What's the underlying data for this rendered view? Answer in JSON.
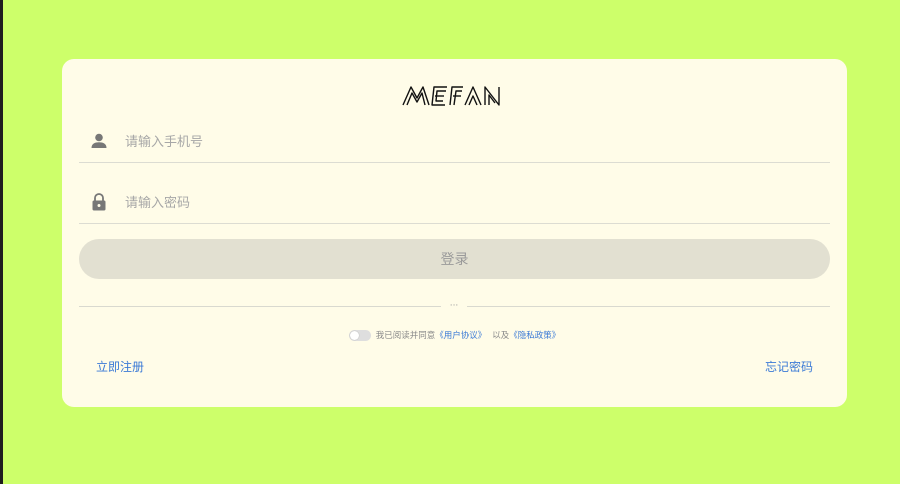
{
  "brand": {
    "logo_text": "MEFAN"
  },
  "colors": {
    "background": "#cdff6a",
    "card": "#fffce8",
    "link": "#3b7ad6",
    "button": "#e2e0d1"
  },
  "login_form": {
    "phone_placeholder": "请输入手机号",
    "password_placeholder": "请输入密码",
    "phone_icon": "user-icon",
    "password_icon": "lock-icon",
    "submit_label": "登录",
    "divider_text": "···"
  },
  "agreement": {
    "prefix": "我已阅读并同意",
    "user_agreement": "《用户协议》",
    "connector": "以及",
    "privacy_policy": "《隐私政策》",
    "accepted": false
  },
  "footer": {
    "register_label": "立即注册",
    "forgot_label": "忘记密码"
  }
}
